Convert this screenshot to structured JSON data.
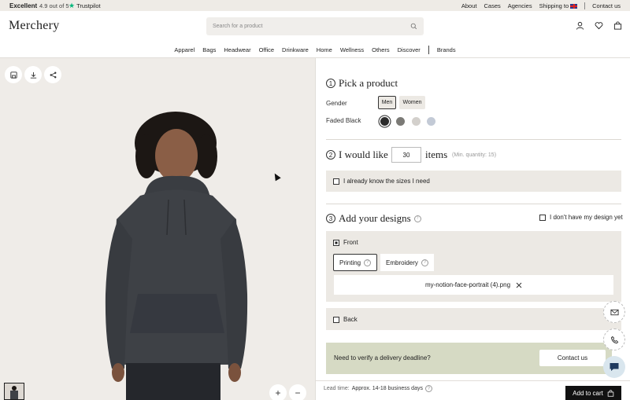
{
  "topbar": {
    "excellent": "Excellent",
    "rating": "4.9 out of 5",
    "trustpilot": "Trustpilot",
    "links": [
      "About",
      "Cases",
      "Agencies",
      "Shipping to",
      "Contact us"
    ]
  },
  "header": {
    "logo": "Merchery",
    "search_placeholder": "Search for a product"
  },
  "nav": [
    "Apparel",
    "Bags",
    "Headwear",
    "Office",
    "Drinkware",
    "Home",
    "Wellness",
    "Others",
    "Discover",
    "Brands"
  ],
  "step1": {
    "num": "1",
    "title": "Pick a product",
    "gender_label": "Gender",
    "gender_options": [
      "Men",
      "Women"
    ],
    "gender_selected": "Men",
    "color_label": "Faded Black",
    "colors": [
      "#2b2b2b",
      "#7b7a76",
      "#d3d0cc",
      "#c3cad6"
    ]
  },
  "step2": {
    "num": "2",
    "prefix": "I would like",
    "quantity": "30",
    "suffix": "items",
    "min_note": "(Min. quantity: 15)",
    "sizes_label": "I already know the sizes I need"
  },
  "step3": {
    "num": "3",
    "title": "Add your designs",
    "no_design_label": "I don't have my design yet",
    "front_label": "Front",
    "methods": [
      "Printing",
      "Embroidery"
    ],
    "method_selected": "Printing",
    "file_name": "my-notion-face-portrait (4).png",
    "back_label": "Back"
  },
  "deadline": {
    "text": "Need to verify a delivery deadline?",
    "button": "Contact us"
  },
  "footer": {
    "lead_label": "Lead time:",
    "lead_value": "Approx. 14-18 business days",
    "cart_button": "Add to cart"
  },
  "zoom": {
    "in": "+",
    "out": "−"
  },
  "colors": {
    "accent_bg": "#efece8",
    "deadline_bg": "#d6dac4",
    "cart_bg": "#111111",
    "trustpilot_star": "#00b67a"
  }
}
